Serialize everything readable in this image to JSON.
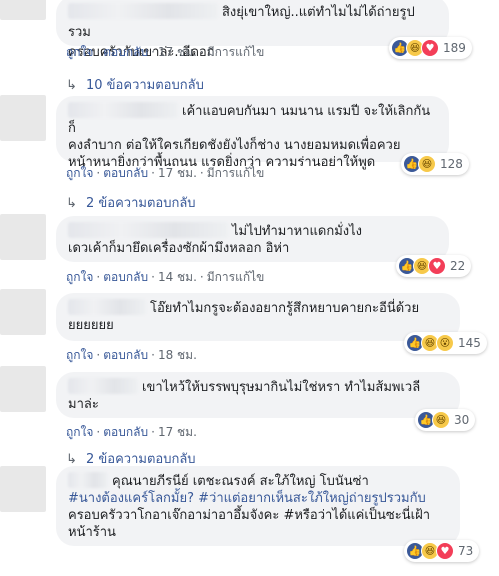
{
  "comments": [
    {
      "name": "",
      "text_lines": [
        "สิงยุ่เขาใหญ่..แต่ทำไมไม่ได้ถ่ายรูปรวม",
        "ครอบครัวกับเขาล่ะ..อีดอก"
      ],
      "reactions": [
        "like",
        "haha",
        "love"
      ],
      "reaction_count": "189",
      "meta": {
        "like": "ถูกใจ",
        "reply": "ตอบกลับ",
        "time": "17 ชม.",
        "edited": "มีการแก้ไข"
      },
      "replies_label": "10 ข้อความตอบกลับ"
    },
    {
      "name": "",
      "text_lines": [
        "เค้าแอบคบกันมา นมนาน แรมปี จะให้เลิกกันก็",
        "คงลำบาก ต่อให้ใครเกียดชังยังไงก็ช่าง นางยอมหมดเพื่อควย",
        "หน้าหนายิ่งกว่าพื้นถนน แรดยิ่งกว่า ความร่านอย่าให้พูด"
      ],
      "reactions": [
        "like",
        "haha"
      ],
      "reaction_count": "128",
      "meta": {
        "like": "ถูกใจ",
        "reply": "ตอบกลับ",
        "time": "17 ชม.",
        "edited": "มีการแก้ไข"
      },
      "replies_label": "2 ข้อความตอบกลับ"
    },
    {
      "name": "",
      "text_lines": [
        "ไม่ไปทำมาหาแดกมั่งไง",
        "เดวเค้าก็มายึดเครื่องซักผ้ามึงหลอก อิห่า"
      ],
      "reactions": [
        "like",
        "haha",
        "love"
      ],
      "reaction_count": "22",
      "meta": {
        "like": "ถูกใจ",
        "reply": "ตอบกลับ",
        "time": "14 ชม.",
        "edited": "มีการแก้ไข"
      }
    },
    {
      "name": "",
      "text_lines": [
        "โอ๊ยทำไมกรูจะต้องอยากรู้สึกหยาบคายกะอีนี่ด้วย",
        "ยยยยยย"
      ],
      "reactions": [
        "like",
        "haha",
        "wow"
      ],
      "reaction_count": "145",
      "meta": {
        "like": "ถูกใจ",
        "reply": "ตอบกลับ",
        "time": "18 ชม."
      }
    },
    {
      "name": "",
      "text_lines": [
        "เขาไหว้ให้บรรพบุรุษมากินไม่ใช่หรา ทำไมส้มพเวลี",
        "มาล่ะ"
      ],
      "reactions": [
        "like",
        "haha"
      ],
      "reaction_count": "30",
      "meta": {
        "like": "ถูกใจ",
        "reply": "ตอบกลับ",
        "time": "17 ชม."
      },
      "replies_label": "2 ข้อความตอบกลับ"
    },
    {
      "name": "",
      "text_lines": [
        "คุณนายภีรนีย์ เตชะณรงค์ สะใภ้ใหญ่ โบนันซ่า",
        "#นางต้องแคร์โลกมั้ย? #ว่าแต่อยากเห็นสะใภ้ใหญ่ถ่ายรูปรวมกับ",
        "ครอบครัววาโกอาเจ๊กอาม่าอาอึ้มจังคะ #หรือว่าได้แค่เป็นซะนี่เฝ้า",
        "หน้าร้าน"
      ],
      "reactions": [
        "like",
        "haha",
        "love"
      ],
      "reaction_count": "73"
    }
  ],
  "colors": {
    "link": "#385898",
    "meta": "#606770",
    "bubble": "#f2f3f5",
    "like": "#3b5998",
    "love": "#f33e58",
    "haha": "#f7c94a"
  }
}
